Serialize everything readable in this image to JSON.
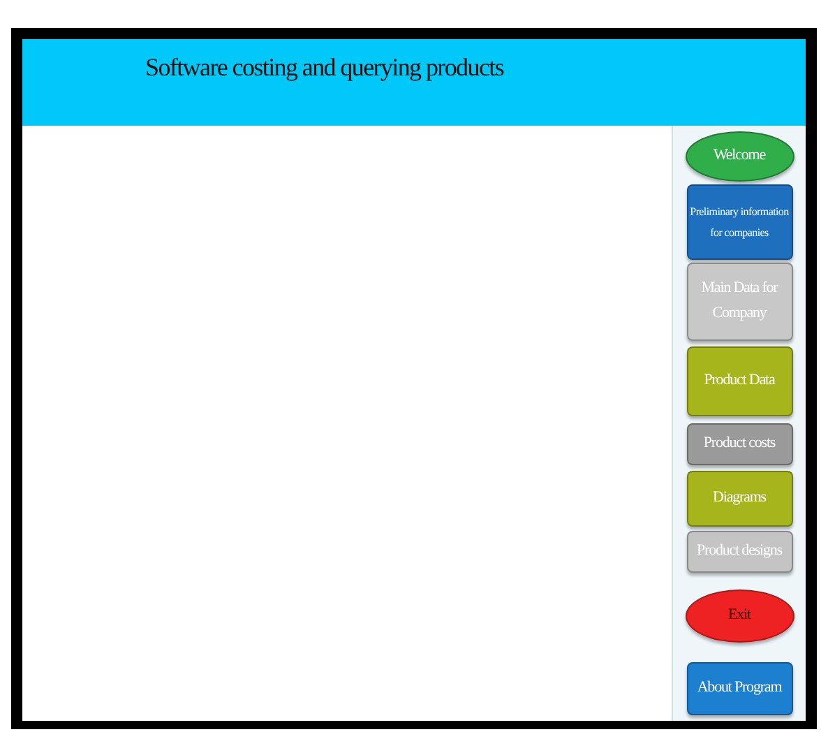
{
  "header": {
    "title": "Software costing and querying products"
  },
  "sidebar": {
    "items": [
      {
        "label": "Welcome",
        "kind": "oval",
        "color": "#2fae4a"
      },
      {
        "label": "Preliminary information for companies",
        "kind": "rect",
        "color": "#1f6fbf"
      },
      {
        "label": "Main Data for Company",
        "kind": "rect",
        "color": "#c8c8c8"
      },
      {
        "label": "Product Data",
        "kind": "rect",
        "color": "#a7b51c"
      },
      {
        "label": "Product costs",
        "kind": "rect",
        "color": "#9a9a9a"
      },
      {
        "label": "Diagrams",
        "kind": "rect",
        "color": "#a7b51c"
      },
      {
        "label": "Product designs",
        "kind": "rect",
        "color": "#c4c4c4"
      },
      {
        "label": "Exit",
        "kind": "oval",
        "color": "#ee2222"
      },
      {
        "label": "About Program",
        "kind": "rect",
        "color": "#1c7fd0"
      }
    ]
  }
}
